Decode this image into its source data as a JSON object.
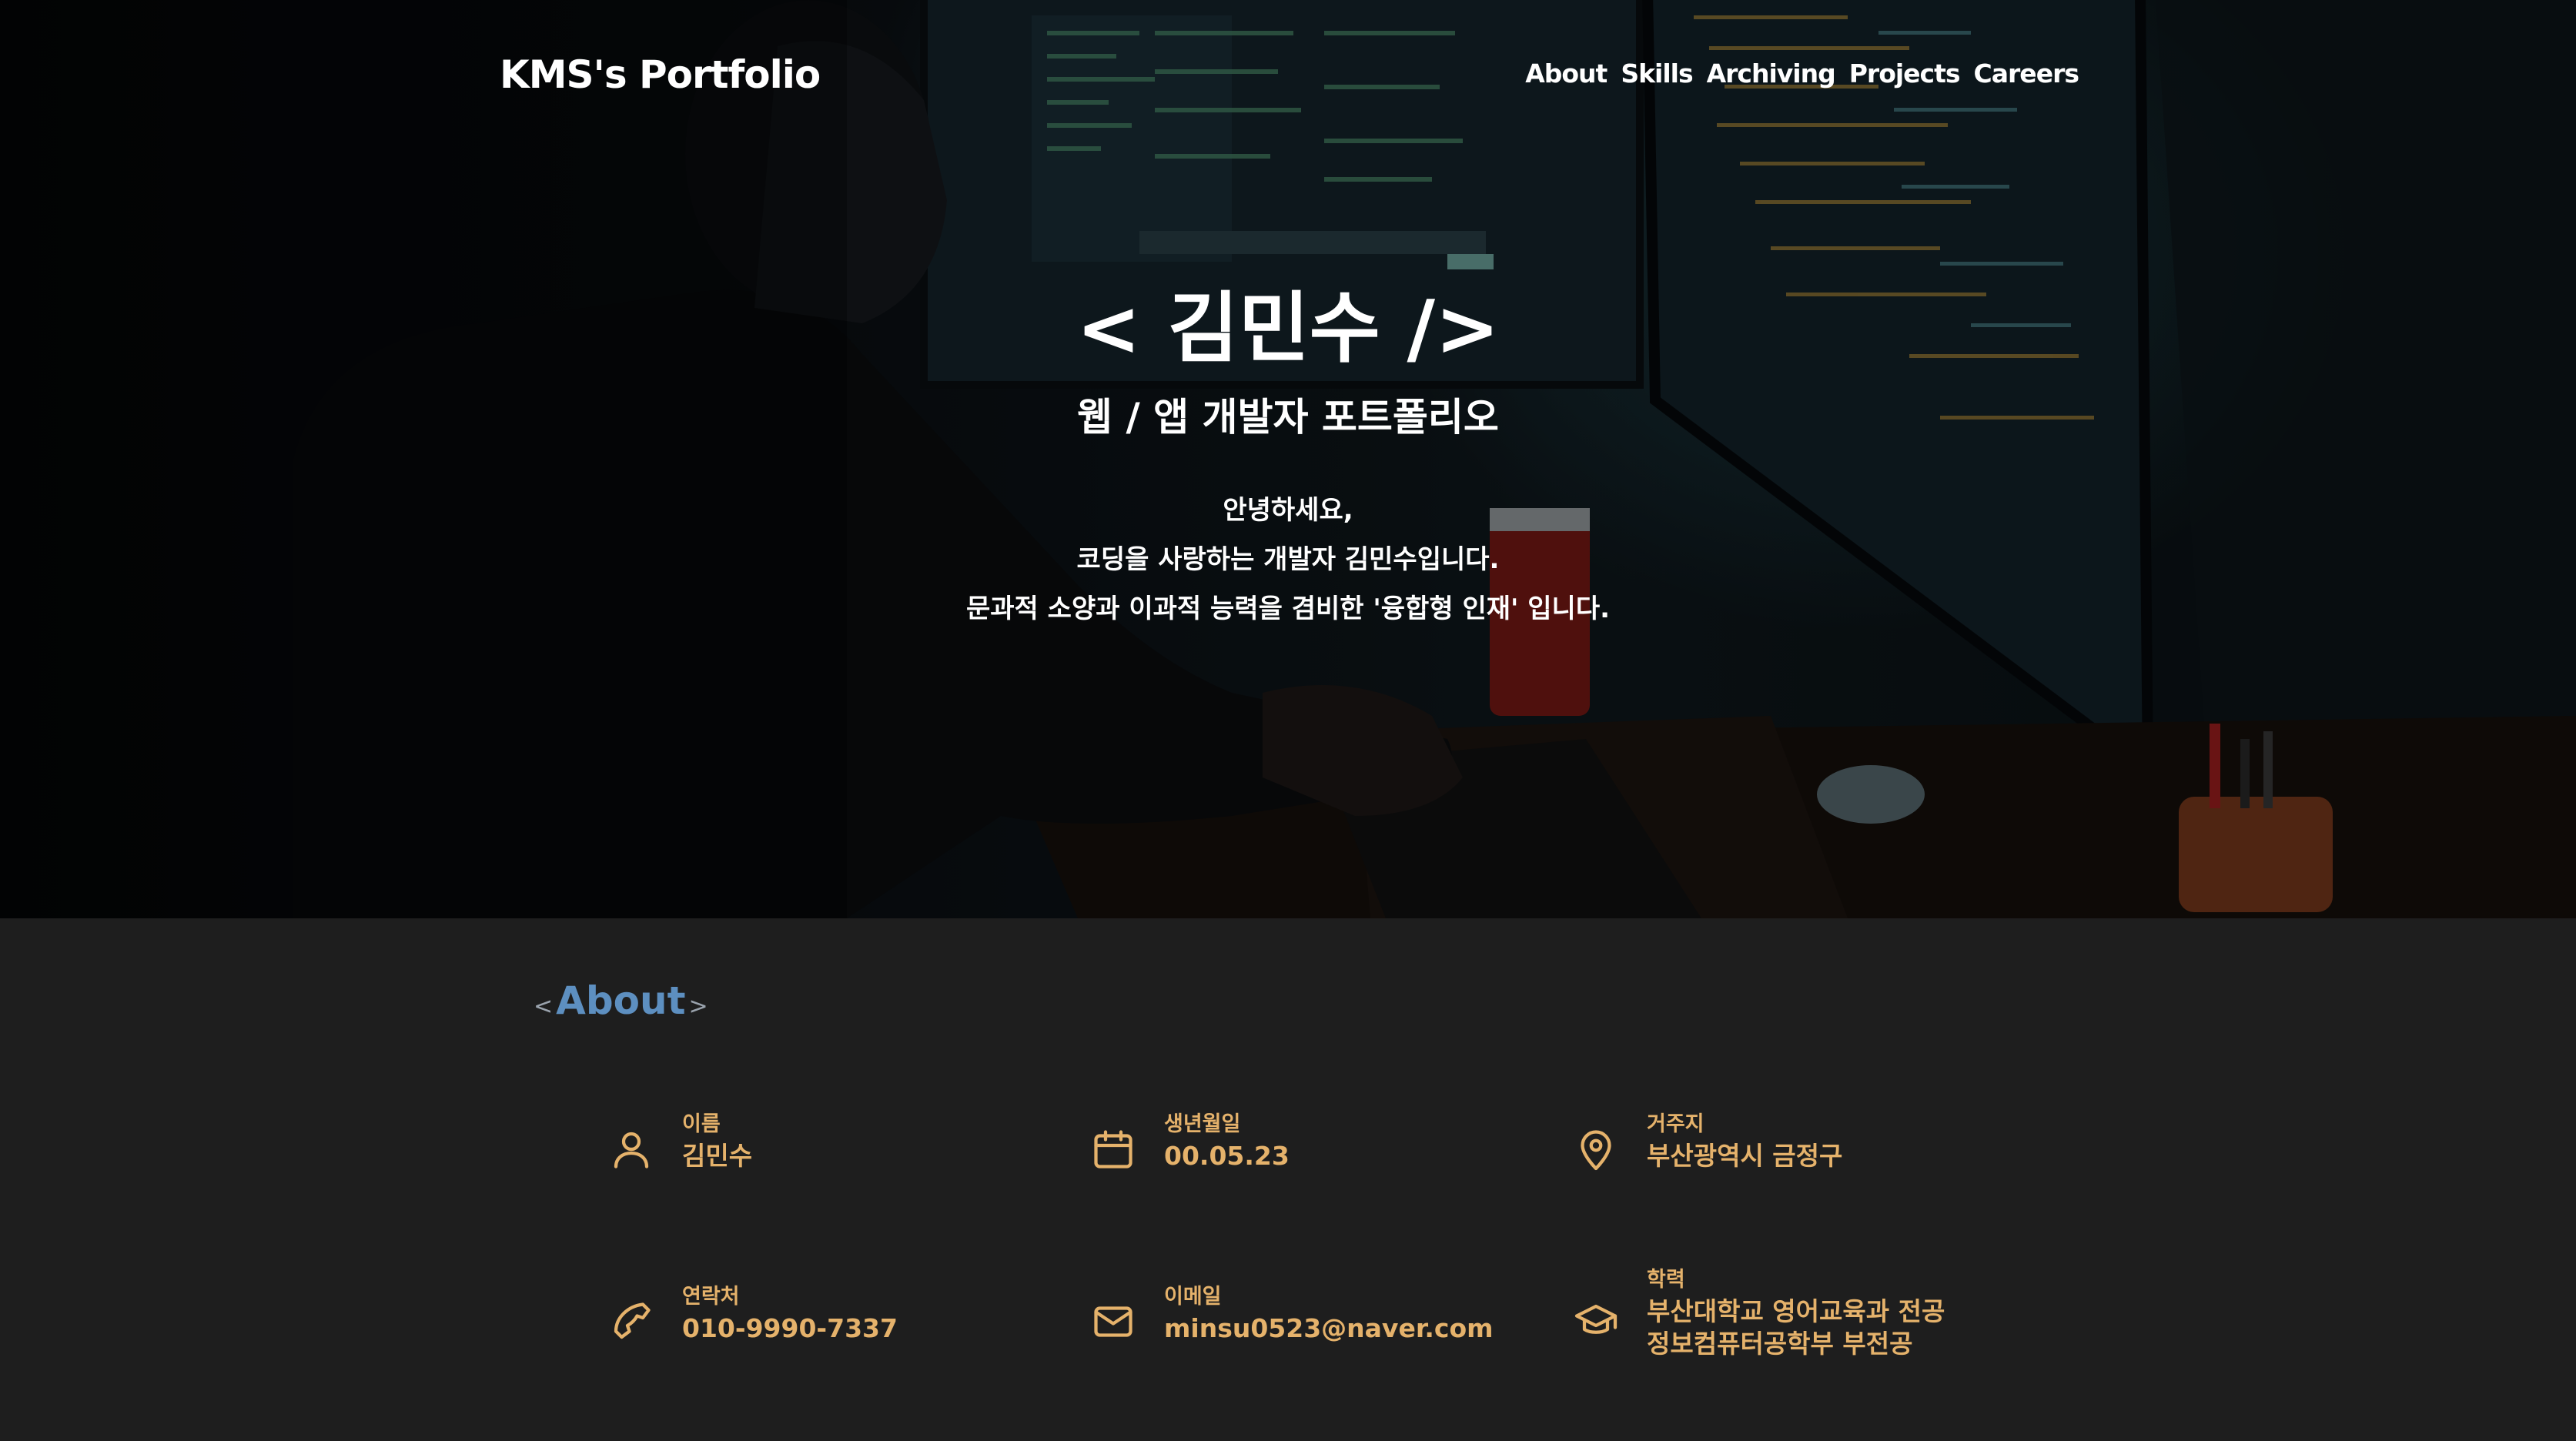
{
  "nav": {
    "brand": "KMS's Portfolio",
    "links": [
      "About",
      "Skills",
      "Archiving",
      "Projects",
      "Careers"
    ]
  },
  "hero": {
    "title": "< 김민수 />",
    "subtitle": "웹 / 앱 개발자 포트폴리오",
    "lines": [
      "안녕하세요,",
      "코딩을 사랑하는 개발자 김민수입니다.",
      "문과적 소양과 이과적 능력을 겸비한 '융합형 인재' 입니다."
    ]
  },
  "about": {
    "bracket_open": "<",
    "heading": "About",
    "bracket_close": ">",
    "items": [
      {
        "icon": "user-icon",
        "label": "이름",
        "value": "김민수"
      },
      {
        "icon": "calendar-icon",
        "label": "생년월일",
        "value": "00.05.23"
      },
      {
        "icon": "map-pin-icon",
        "label": "거주지",
        "value": "부산광역시 금정구"
      },
      {
        "icon": "phone-icon",
        "label": "연락처",
        "value": "010-9990-7337"
      },
      {
        "icon": "mail-icon",
        "label": "이메일",
        "value": "minsu0523@naver.com"
      },
      {
        "icon": "graduation-cap-icon",
        "label": "학력",
        "value": "부산대학교 영어교육과 전공",
        "value2": "정보컴퓨터공학부 부전공"
      }
    ]
  },
  "colors": {
    "accent": "#e5b26b",
    "heading": "#5d8fc0",
    "background": "#1e1e1e"
  }
}
